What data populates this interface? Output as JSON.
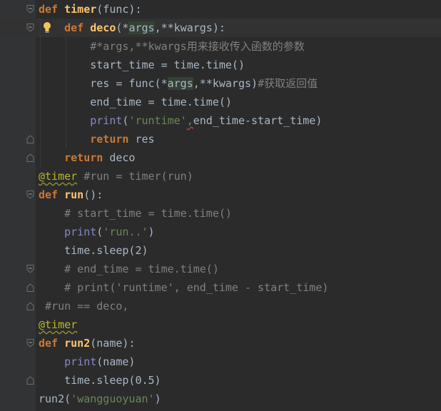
{
  "editor": {
    "lines": [
      {
        "id": "l1",
        "tokens": [
          [
            "kw",
            "def"
          ],
          [
            "",
            " "
          ],
          [
            "fn",
            "timer"
          ],
          [
            "",
            "(func):"
          ]
        ]
      },
      {
        "id": "l2",
        "tokens": [
          [
            "",
            "    "
          ],
          [
            "kw",
            "def"
          ],
          [
            "",
            " "
          ],
          [
            "fn",
            "deco"
          ],
          [
            "",
            "(*"
          ],
          [
            "hl",
            "args"
          ],
          [
            "",
            ",**kwargs):"
          ]
        ]
      },
      {
        "id": "l3",
        "tokens": [
          [
            "",
            "        "
          ],
          [
            "cmt",
            "#*args,**kwargs用来接收传入函数的参数"
          ]
        ]
      },
      {
        "id": "l4",
        "tokens": [
          [
            "",
            "        start_time = time.time()"
          ]
        ]
      },
      {
        "id": "l5",
        "tokens": [
          [
            "",
            "        res = func(*"
          ],
          [
            "hl",
            "args"
          ],
          [
            "",
            ",**kwargs)"
          ],
          [
            "cmt",
            "#获取返回值"
          ]
        ]
      },
      {
        "id": "l6",
        "tokens": [
          [
            "",
            "        end_time = time.time()"
          ]
        ]
      },
      {
        "id": "l7",
        "tokens": [
          [
            "",
            "        "
          ],
          [
            "builtin",
            "print"
          ],
          [
            "",
            "("
          ],
          [
            "str",
            "'runtime'"
          ],
          [
            "err",
            ","
          ],
          [
            "",
            "end_time-start_time)"
          ]
        ]
      },
      {
        "id": "l8",
        "tokens": [
          [
            "",
            "        "
          ],
          [
            "kw",
            "return"
          ],
          [
            "",
            " res"
          ]
        ]
      },
      {
        "id": "l9",
        "tokens": [
          [
            "",
            "    "
          ],
          [
            "kw",
            "return"
          ],
          [
            "",
            " deco"
          ]
        ]
      },
      {
        "id": "l10",
        "tokens": [
          [
            "dec",
            "@timer"
          ],
          [
            "cmt",
            " #run = timer(run)"
          ]
        ]
      },
      {
        "id": "l11",
        "tokens": [
          [
            "kw",
            "def"
          ],
          [
            "",
            " "
          ],
          [
            "fn",
            "run"
          ],
          [
            "",
            "():"
          ]
        ]
      },
      {
        "id": "l12",
        "tokens": [
          [
            "",
            "    "
          ],
          [
            "cmt",
            "# start_time = time.time()"
          ]
        ]
      },
      {
        "id": "l13",
        "tokens": [
          [
            "",
            "    "
          ],
          [
            "builtin",
            "print"
          ],
          [
            "",
            "("
          ],
          [
            "str",
            "'run..'"
          ],
          [
            "",
            ")"
          ]
        ]
      },
      {
        "id": "l14",
        "tokens": [
          [
            "",
            "    time.sleep(2)"
          ]
        ]
      },
      {
        "id": "l15",
        "tokens": [
          [
            "",
            "    "
          ],
          [
            "cmt",
            "# end_time = time.time()"
          ]
        ]
      },
      {
        "id": "l16",
        "tokens": [
          [
            "",
            "    "
          ],
          [
            "cmt",
            "# print('runtime', end_time - start_time)"
          ]
        ]
      },
      {
        "id": "l17",
        "tokens": [
          [
            "cmt",
            " #run == deco,"
          ]
        ]
      },
      {
        "id": "l18",
        "tokens": [
          [
            "dec",
            "@timer"
          ]
        ]
      },
      {
        "id": "l19",
        "tokens": [
          [
            "kw",
            "def"
          ],
          [
            "",
            " "
          ],
          [
            "fn",
            "run2"
          ],
          [
            "",
            "(name):"
          ]
        ]
      },
      {
        "id": "l20",
        "tokens": [
          [
            "",
            "    "
          ],
          [
            "builtin",
            "print"
          ],
          [
            "",
            "(name)"
          ]
        ]
      },
      {
        "id": "l21",
        "tokens": [
          [
            "",
            "    time.sleep(0.5)"
          ]
        ]
      },
      {
        "id": "l22",
        "tokens": [
          [
            "",
            "run2("
          ],
          [
            "str",
            "'wangguoyuan'"
          ],
          [
            "",
            ")"
          ]
        ]
      }
    ],
    "icons": {
      "intention": "lightbulb-icon",
      "fold": "fold-marker-icon"
    },
    "colors": {
      "background": "#2b2b2b",
      "gutter": "#313335",
      "keyword": "#cc7832",
      "function": "#ffc66d",
      "builtin": "#8888c6",
      "string": "#6a8759",
      "comment": "#808080",
      "decorator": "#bbb529",
      "text": "#a9b7c6"
    }
  }
}
